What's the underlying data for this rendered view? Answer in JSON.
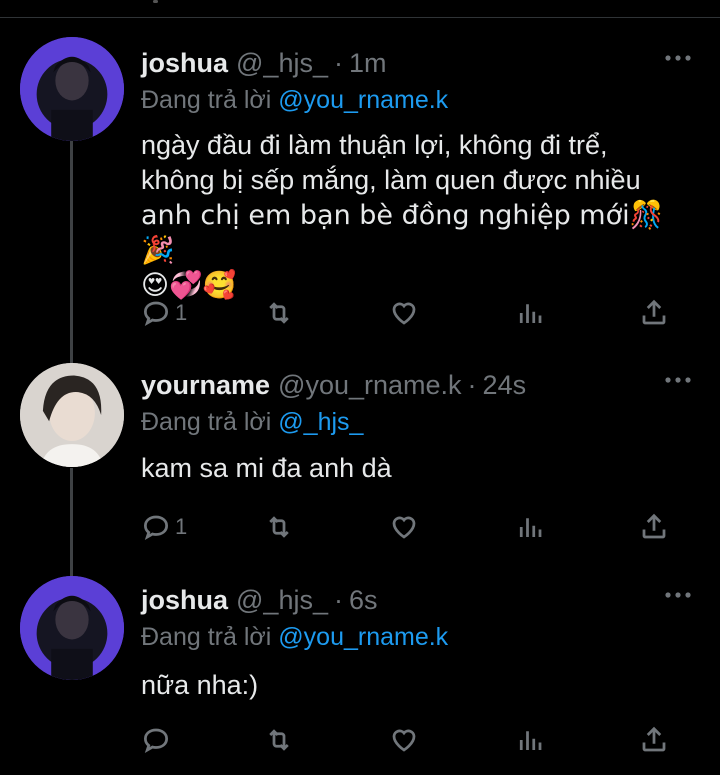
{
  "tweets": [
    {
      "name": "joshua",
      "handle": "@_hjs_",
      "dot": "·",
      "time": "1m",
      "replying_prefix": "Đang trả lời ",
      "replying_to": "@you_rname.k",
      "text_lines": [
        "ngày đầu đi làm thuận lợi, không đi trể,",
        "không bị sếp mắng, làm quen được nhiều",
        "anh chị em bạn bè đồng nghiệp mới🎊🎉",
        "😍💞🥰"
      ],
      "reply_count": "1"
    },
    {
      "name": "yourname",
      "handle": "@you_rname.k",
      "dot": "·",
      "time": "24s",
      "replying_prefix": "Đang trả lời ",
      "replying_to": "@_hjs_",
      "text_lines": [
        "kam sa mi đa anh dà"
      ],
      "reply_count": "1"
    },
    {
      "name": "joshua",
      "handle": "@_hjs_",
      "dot": "·",
      "time": "6s",
      "replying_prefix": "Đang trả lời ",
      "replying_to": "@you_rname.k",
      "text_lines": [
        "nữa nha:)"
      ],
      "reply_count": ""
    }
  ],
  "icons": [
    "reply-icon",
    "retweet-icon",
    "like-icon",
    "views-icon",
    "share-icon",
    "more-icon"
  ],
  "colors": {
    "background": "#000000",
    "text": "#e7e9ea",
    "muted": "#71767b",
    "accent": "#1d9bf0",
    "josh_avatar": "#5b3fd6"
  }
}
